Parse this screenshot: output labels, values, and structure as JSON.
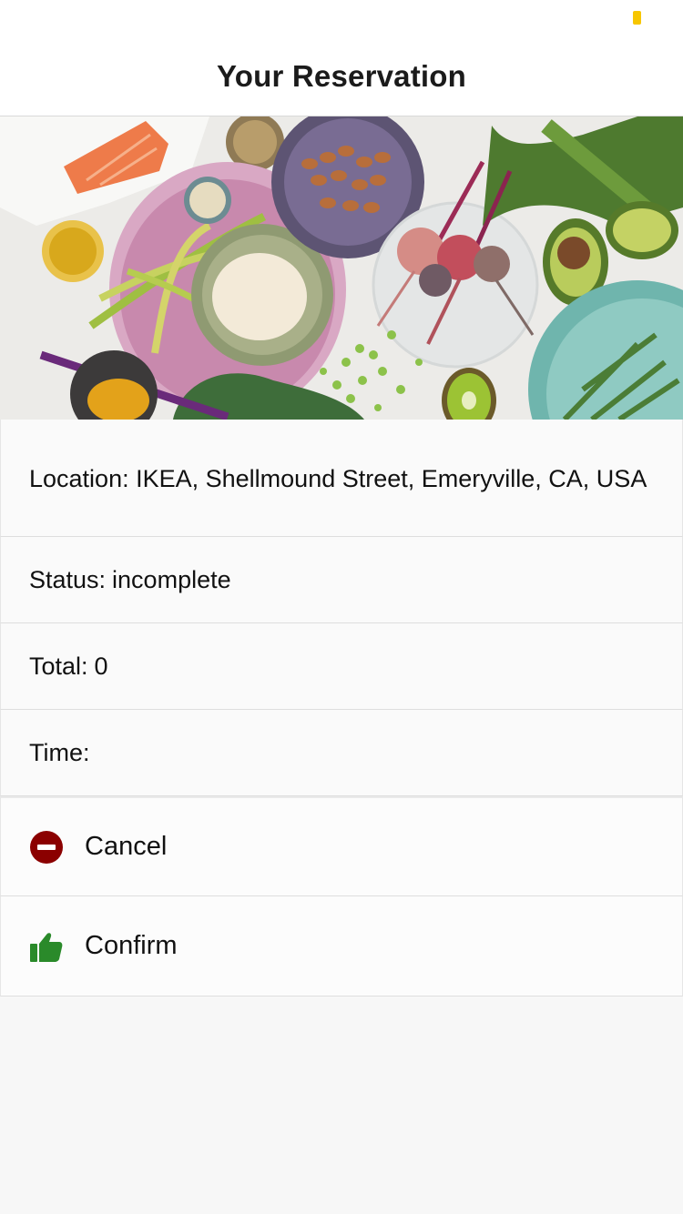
{
  "header": {
    "title": "Your Reservation"
  },
  "details": {
    "location_prefix": "Location:",
    "location": "IKEA, Shellmound Street, Emeryville, CA, USA",
    "status_prefix": "Status:",
    "status": "incomplete",
    "total_prefix": "Total:",
    "total": "0",
    "time_prefix": "Time:",
    "time": ""
  },
  "actions": {
    "cancel": {
      "label": "Cancel",
      "icon": "minus-circle-icon",
      "color": "#8b0000"
    },
    "confirm": {
      "label": "Confirm",
      "icon": "thumbs-up-icon",
      "color": "#2a8a2a"
    }
  },
  "colors": {
    "battery": "#f7c600",
    "background": "#f7f7f7"
  }
}
